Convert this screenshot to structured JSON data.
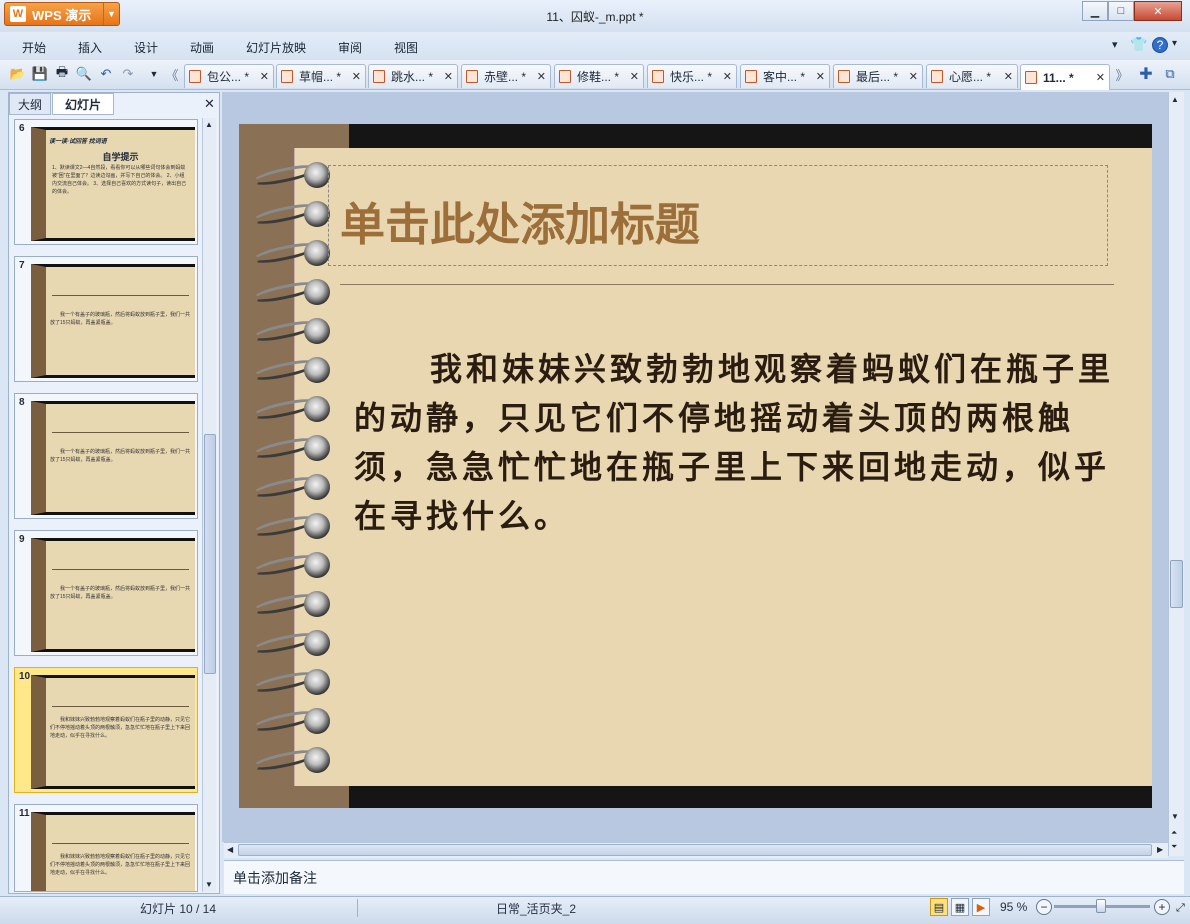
{
  "app": {
    "name": "WPS 演示",
    "window_title": "11、囚蚁-_m.ppt *"
  },
  "menu": [
    "开始",
    "插入",
    "设计",
    "动画",
    "幻灯片放映",
    "审阅",
    "视图"
  ],
  "tabs": [
    {
      "label": "包公... *"
    },
    {
      "label": "草帽... *"
    },
    {
      "label": "跳水... *"
    },
    {
      "label": "赤壁... *"
    },
    {
      "label": "修鞋... *"
    },
    {
      "label": "快乐... *"
    },
    {
      "label": "客中... *"
    },
    {
      "label": "最后... *"
    },
    {
      "label": "心愿... *"
    },
    {
      "label": "11... *"
    }
  ],
  "panel": {
    "tab_outline": "大纲",
    "tab_slides": "幻灯片"
  },
  "thumbnails": [
    {
      "num": "6",
      "title": "读一读·试回答 找词语",
      "heading": "自学提示",
      "text": "1、默读课文2—4自然段，看看你可以从哪些词句体会到蚂蚁被“困”在里面了？边读边勾画，并写下自己的体会。 2、小组内交流自己体会。 3、选择自己喜欢的方式读句子，读出自己的体会。"
    },
    {
      "num": "7",
      "text": "我一个有盖子的玻璃瓶，然后将蚂蚁放到瓶子里，我们一共放了15只蚂蚁，再盖紧瓶盖。"
    },
    {
      "num": "8",
      "text": "我一个有盖子的玻璃瓶，然后将蚂蚁放到瓶子里，我们一共放了15只蚂蚁，再盖紧瓶盖。"
    },
    {
      "num": "9",
      "text": "我一个有盖子的玻璃瓶，然后将蚂蚁放到瓶子里，我们一共放了15只蚂蚁，再盖紧瓶盖。"
    },
    {
      "num": "10",
      "text": "我和妹妹兴致勃勃地观察着蚂蚁们在瓶子里的动静，只见它们不停地摇动着头顶的两根触须，急急忙忙地在瓶子里上下来回地走动，似乎在寻找什么。"
    },
    {
      "num": "11",
      "text": "我和妹妹兴致勃勃地观察着蚂蚁们在瓶子里的动静，只见它们不停地摇动着头顶的两根触须，急急忙忙地在瓶子里上下来回地走动，似乎在寻找什么。"
    }
  ],
  "slide": {
    "title_placeholder": "单击此处添加标题",
    "body": "我和妹妹兴致勃勃地观察着蚂蚁们在瓶子里的动静，只见它们不停地摇动着头顶的两根触须，急急忙忙地在瓶子里上下来回地走动，似乎在寻找什么。"
  },
  "notes_placeholder": "单击添加备注",
  "status": {
    "slide_counter": "幻灯片 10 / 14",
    "template": "日常_活页夹_2",
    "zoom": "95 %"
  }
}
